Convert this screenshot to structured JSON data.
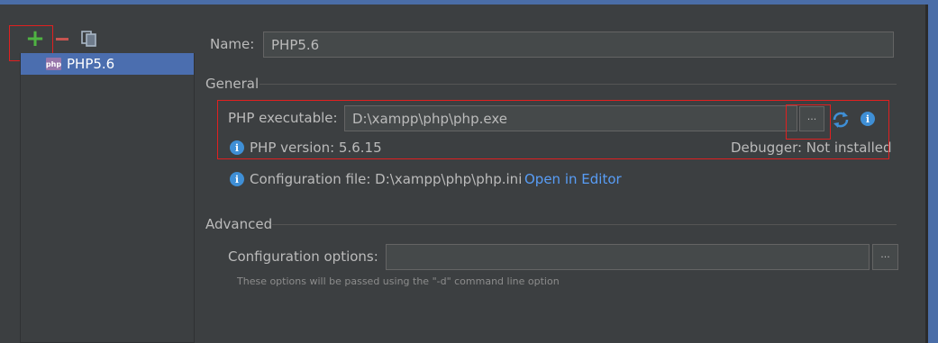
{
  "toolbar": {
    "icons": [
      "plus-icon",
      "minus-icon",
      "copy-icon"
    ]
  },
  "interpreters": [
    {
      "label": "PHP5.6",
      "icon": "php-icon",
      "badge": "php"
    }
  ],
  "form": {
    "name_label": "Name:",
    "name_value": "PHP5.6",
    "general_title": "General",
    "exe_label": "PHP executable:",
    "exe_value": "D:\\xampp\\php\\php.exe",
    "browse_label": "···",
    "php_version": "PHP version: 5.6.15",
    "debugger": "Debugger: Not installed",
    "config_file_label": "Configuration file: D:\\xampp\\php\\php.ini",
    "open_in_editor": "Open in Editor",
    "advanced_title": "Advanced",
    "config_options_label": "Configuration options:",
    "config_options_value": "",
    "config_options_browse": "···",
    "hint": "These options will be passed using the \"-d\" command line option",
    "info_glyph": "i"
  },
  "colors": {
    "background": "#3c3f41",
    "selection": "#4b6eaf",
    "link": "#589df6",
    "highlight": "#e02020",
    "accent": "#4a6da7"
  }
}
